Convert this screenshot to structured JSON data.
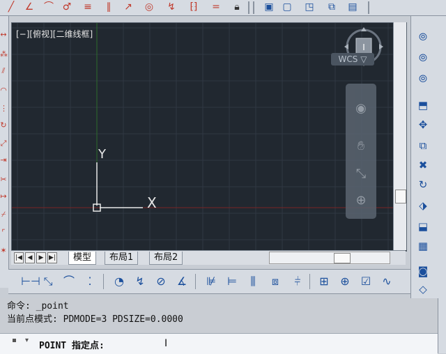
{
  "viewport": {
    "label": "[−][俯视][二维线框]",
    "ucs_y_label": "Y",
    "ucs_x_label": "X",
    "viewcube_face": "I",
    "wcs_label": "WCS ▽"
  },
  "tabs": {
    "model": "模型",
    "layout1": "布局1",
    "layout2": "布局2"
  },
  "command": {
    "history_line1": "命令: _point",
    "history_line2": "当前点模式:  PDMODE=3  PDSIZE=0.0000",
    "prompt": "POINT 指定点:"
  },
  "colors": {
    "viewport_bg": "#212830",
    "grid": "#2f3742",
    "x_axis": "#8b2a2a",
    "y_axis": "#2d6b2d",
    "ucs": "#e8e8e8"
  }
}
